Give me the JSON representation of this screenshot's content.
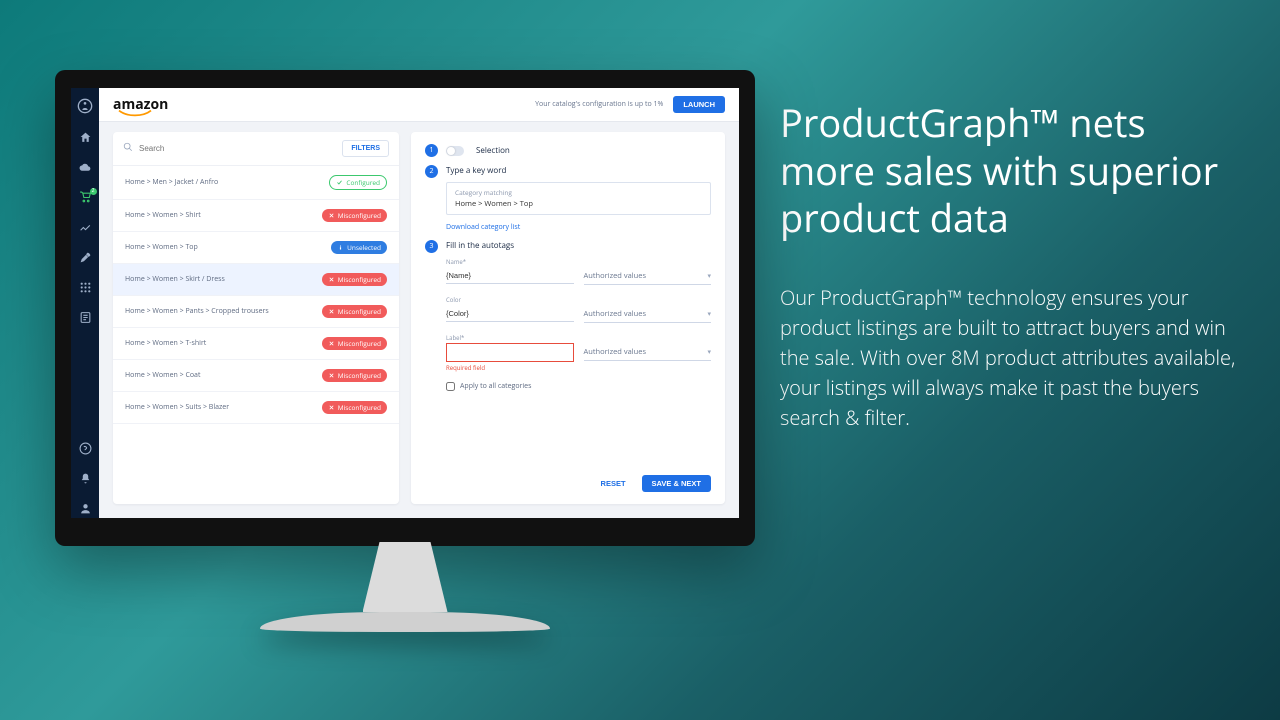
{
  "marketing": {
    "headline": "ProductGraph™ nets more sales with superior product data",
    "body": "Our ProductGraph™ technology ensures your product listings are built to attract buyers and win the sale. With over 8M product attributes available, your listings will always make it past the buyers search & filter."
  },
  "app": {
    "brand": "amazon",
    "status_text": "Your catalog's configuration is up to 1%",
    "launch_label": "LAUNCH",
    "search_placeholder": "Search",
    "filters_label": "FILTERS",
    "sidebar_badge": "2",
    "categories": [
      {
        "name": "Home > Men > Jacket / Anfro",
        "status": "Configured",
        "pill": "outline-green"
      },
      {
        "name": "Home > Women > Shirt",
        "status": "Misconfigured",
        "pill": "red"
      },
      {
        "name": "Home > Women > Top",
        "status": "Unselected",
        "pill": "blue"
      },
      {
        "name": "Home > Women > Skirt / Dress",
        "status": "Misconfigured",
        "pill": "red",
        "selected": true
      },
      {
        "name": "Home > Women > Pants > Cropped trousers",
        "status": "Misconfigured",
        "pill": "red"
      },
      {
        "name": "Home > Women > T-shirt",
        "status": "Misconfigured",
        "pill": "red"
      },
      {
        "name": "Home > Women > Coat",
        "status": "Misconfigured",
        "pill": "red"
      },
      {
        "name": "Home > Women > Suits > Blazer",
        "status": "Misconfigured",
        "pill": "red"
      }
    ],
    "steps": {
      "s1_label": "Selection",
      "s2_label": "Type a key word",
      "s2_box_label": "Category matching",
      "s2_value": "Home > Women > Top",
      "s2_link": "Download category list",
      "s3_label": "Fill in the autotags",
      "fields": [
        {
          "label": "Name*",
          "value": "{Name}",
          "select": "Authorized values"
        },
        {
          "label": "Color",
          "value": "{Color}",
          "select": "Authorized values"
        },
        {
          "label": "Label*",
          "value": "",
          "select": "Authorized values",
          "error": "Required field"
        }
      ],
      "apply_all": "Apply to all categories"
    },
    "footer": {
      "reset": "RESET",
      "save": "SAVE & NEXT"
    }
  }
}
